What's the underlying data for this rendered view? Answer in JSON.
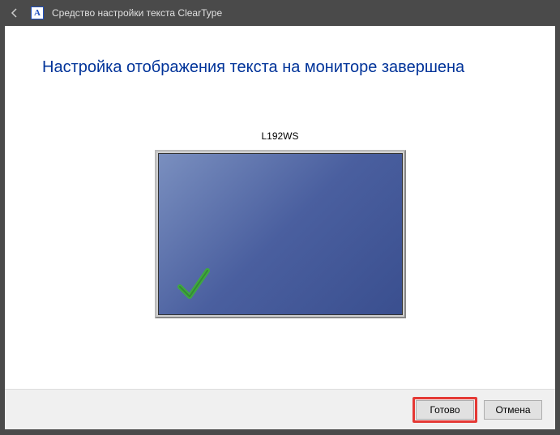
{
  "titlebar": {
    "app_letter": "A",
    "title": "Средство настройки текста ClearType"
  },
  "content": {
    "heading": "Настройка отображения текста на мониторе завершена",
    "monitor_name": "L192WS"
  },
  "footer": {
    "finish_label": "Готово",
    "cancel_label": "Отмена"
  }
}
